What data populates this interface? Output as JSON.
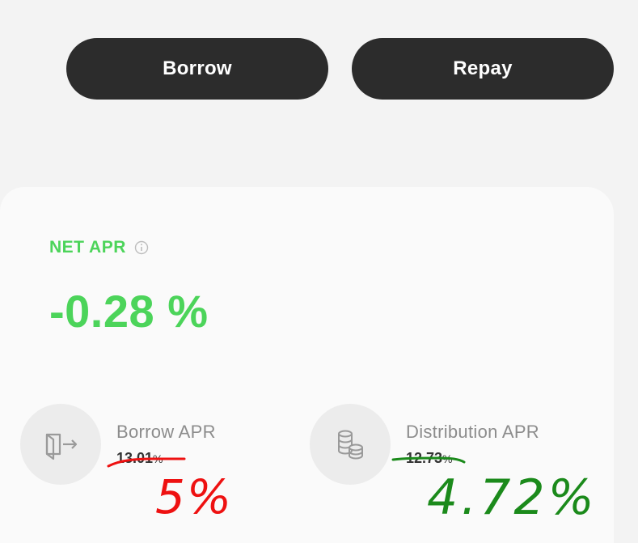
{
  "actions": {
    "borrow_label": "Borrow",
    "repay_label": "Repay"
  },
  "net_apr": {
    "label": "NET APR",
    "value": "-0.28 %"
  },
  "stats": {
    "borrow": {
      "title": "Borrow APR",
      "old_value": "13.01",
      "old_unit": "%",
      "new_value": "5%"
    },
    "distribution": {
      "title": "Distribution APR",
      "old_value": "12.73",
      "old_unit": "%",
      "new_value": "4.72%"
    }
  },
  "colors": {
    "accent_green": "#4cd45a",
    "button_dark": "#2c2c2c",
    "annotation_red": "#ee1111",
    "annotation_green": "#1b8a1b"
  },
  "icons": {
    "borrow": "exit-door-icon",
    "distribution": "coins-stack-icon",
    "info": "info-icon"
  }
}
